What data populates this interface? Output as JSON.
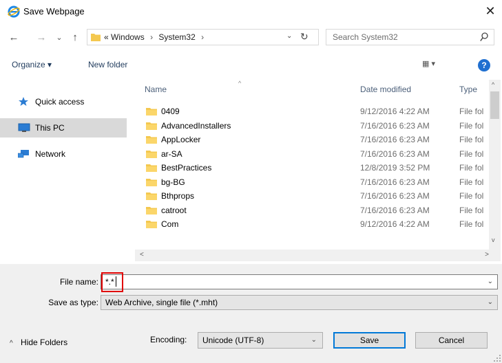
{
  "window": {
    "title": "Save Webpage",
    "close_glyph": "✕",
    "icon": "internet-explorer-icon"
  },
  "nav": {
    "back_glyph": "←",
    "forward_glyph": "→",
    "recent_glyph": "⌄",
    "up_glyph": "↑",
    "breadcrumb": {
      "overflow": "«",
      "items": [
        "Windows",
        "System32"
      ],
      "trailing_sep": "›"
    },
    "refresh_glyph": "↻",
    "search_placeholder": "Search System32"
  },
  "toolbar": {
    "organize_label": "Organize ▾",
    "new_folder_label": "New folder",
    "view_label": "▦ ▾",
    "help_label": "?"
  },
  "sidebar": {
    "items": [
      {
        "label": "Quick access",
        "icon": "star-icon",
        "selected": false
      },
      {
        "label": "This PC",
        "icon": "computer-icon",
        "selected": true
      },
      {
        "label": "Network",
        "icon": "network-icon",
        "selected": false
      }
    ]
  },
  "filelist": {
    "columns": [
      "Name",
      "Date modified",
      "Type"
    ],
    "sort_arrow": "^",
    "rows": [
      {
        "name": "0409",
        "date": "9/12/2016 4:22 AM",
        "type": "File fol"
      },
      {
        "name": "AdvancedInstallers",
        "date": "7/16/2016 6:23 AM",
        "type": "File fol"
      },
      {
        "name": "AppLocker",
        "date": "7/16/2016 6:23 AM",
        "type": "File fol"
      },
      {
        "name": "ar-SA",
        "date": "7/16/2016 6:23 AM",
        "type": "File fol"
      },
      {
        "name": "BestPractices",
        "date": "12/8/2019 3:52 PM",
        "type": "File fol"
      },
      {
        "name": "bg-BG",
        "date": "7/16/2016 6:23 AM",
        "type": "File fol"
      },
      {
        "name": "Bthprops",
        "date": "7/16/2016 6:23 AM",
        "type": "File fol"
      },
      {
        "name": "catroot",
        "date": "7/16/2016 6:23 AM",
        "type": "File fol"
      },
      {
        "name": "Com",
        "date": "9/12/2016 4:22 AM",
        "type": "File fol"
      }
    ]
  },
  "scrollbars": {
    "up": "^",
    "down": "v",
    "left": "<",
    "right": ">"
  },
  "form": {
    "file_name_label": "File name:",
    "file_name_value": "*.*",
    "save_as_type_label": "Save as type:",
    "save_as_type_value": "Web Archive, single file (*.mht)",
    "dropdown_glyph": "⌄",
    "hide_folders_label": "Hide Folders",
    "hide_folders_glyph": "^",
    "encoding_label": "Encoding:",
    "encoding_value": "Unicode (UTF-8)",
    "save_label": "Save",
    "cancel_label": "Cancel"
  },
  "colors": {
    "accent": "#0078d7",
    "highlight_box": "#e00000",
    "folder": "#f4c84f",
    "selected_bg": "#d9d9d9"
  }
}
